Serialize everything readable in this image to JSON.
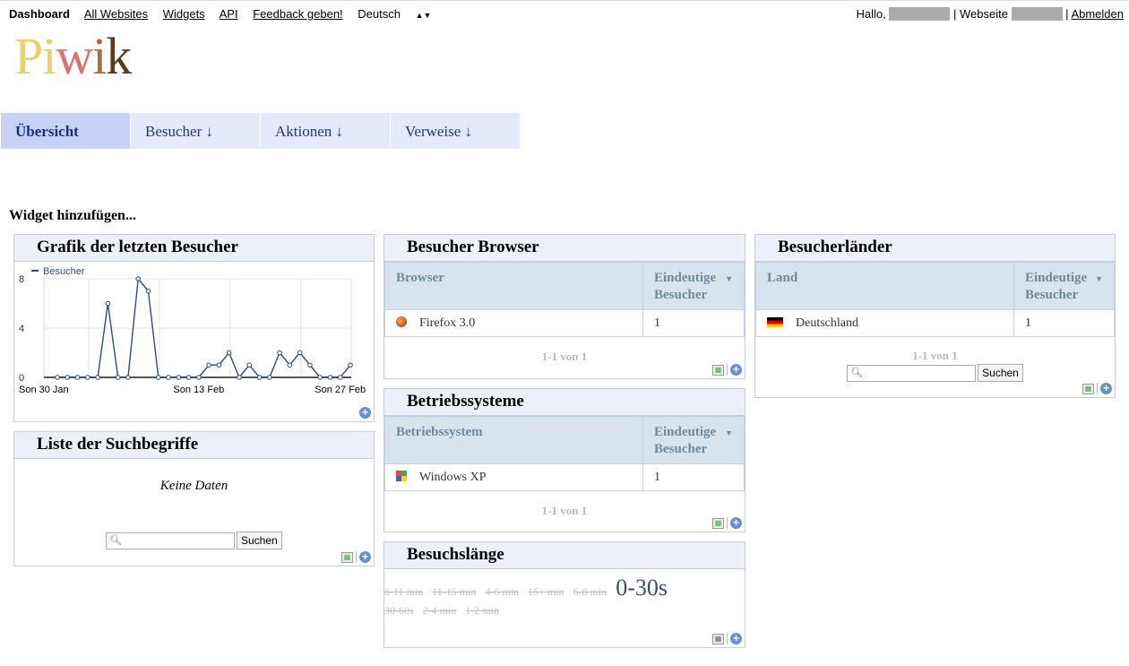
{
  "topbar": {
    "dashboard": "Dashboard",
    "all_websites": "All Websites",
    "widgets": "Widgets",
    "api": "API",
    "feedback": "Feedback geben!",
    "language": "Deutsch",
    "hello": "Hallo,",
    "website": "| Webseite",
    "logout": "Abmelden"
  },
  "logo": {
    "text": "Piwik",
    "colors": [
      "#e8d167",
      "#e8d167",
      "#e26f70",
      "#b06a3c",
      "#5a3b1e"
    ]
  },
  "tabs": [
    {
      "label": "Übersicht"
    },
    {
      "label": "Besucher ↓"
    },
    {
      "label": "Aktionen ↓"
    },
    {
      "label": "Verweise ↓"
    }
  ],
  "add_widget": "Widget hinzufügen...",
  "visitors_graph": {
    "title": "Grafik der letzten Besucher",
    "chart_data": {
      "type": "line",
      "series": [
        {
          "name": "Besucher",
          "values": [
            0,
            0,
            0,
            0,
            0,
            6,
            0,
            0,
            8,
            7,
            0,
            0,
            0,
            0,
            0,
            1,
            1,
            2,
            0,
            1,
            0,
            0,
            2,
            1,
            2,
            1,
            0,
            0,
            0,
            1
          ]
        }
      ],
      "x_labels": [
        "Son 30 Jan",
        "Son 13 Feb",
        "Son 27 Feb"
      ],
      "y_ticks": [
        0,
        4,
        8
      ],
      "ylim": [
        0,
        8
      ],
      "color": "#2e4d7f"
    }
  },
  "search_terms": {
    "title": "Liste der Suchbegriffe",
    "no_data": "Keine Daten",
    "search_button": "Suchen"
  },
  "browsers": {
    "title": "Besucher Browser",
    "col1": "Browser",
    "col2": "Eindeutige Besucher",
    "rows": [
      {
        "label": "Firefox 3.0",
        "value": "1"
      }
    ],
    "pager": "1-1 von 1"
  },
  "os": {
    "title": "Betriebssysteme",
    "col1": "Betriebssystem",
    "col2": "Eindeutige Besucher",
    "rows": [
      {
        "label": "Windows XP",
        "value": "1"
      }
    ],
    "pager": "1-1 von 1"
  },
  "visit_length": {
    "title": "Besuchslänge",
    "tags_row1": [
      "8-11 min",
      "11-15 min",
      "4-6 min",
      "15+ min",
      "6-8 min"
    ],
    "big_tag": "0-30s",
    "tags_row2": [
      "30-60s",
      "2-4 min",
      "1-2 min"
    ]
  },
  "countries": {
    "title": "Besucherländer",
    "col1": "Land",
    "col2": "Eindeutige Besucher",
    "rows": [
      {
        "label": "Deutschland",
        "value": "1"
      }
    ],
    "pager": "1-1 von 1",
    "search_button": "Suchen"
  }
}
